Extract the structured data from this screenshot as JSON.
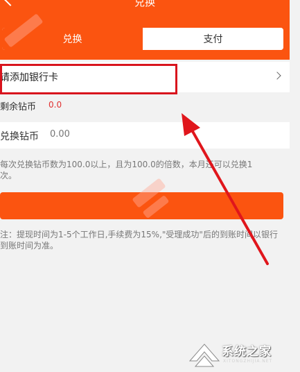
{
  "header": {
    "title": "兑换",
    "back_icon": "chevron-left-icon"
  },
  "tabs": [
    {
      "label": "兑换",
      "active": true
    },
    {
      "label": "支付",
      "active": false
    }
  ],
  "bank_card": {
    "label": "请添加银行卡",
    "chevron_icon": "chevron-right-icon"
  },
  "balance": {
    "label": "剩余钻币",
    "value": "0.0"
  },
  "exchange": {
    "label": "兑换钻币",
    "placeholder": "0.00"
  },
  "rule_text": "每次兑换钻币数为100.0以上，且为100.0的倍数，本月还可以兑换1次。",
  "submit_label": "",
  "note_text": "注：提现时间为1-5个工作日,手续费为15%,\"受理成功\"后的到账时间以银行到账时间为准。",
  "watermark": {
    "text": "系统之家",
    "subtext": "XITONGZHIJIA.NET"
  },
  "colors": {
    "primary": "#fb5410",
    "highlight_box": "#d8141d",
    "arrow": "#e0161c",
    "balance_value": "#e03030"
  }
}
